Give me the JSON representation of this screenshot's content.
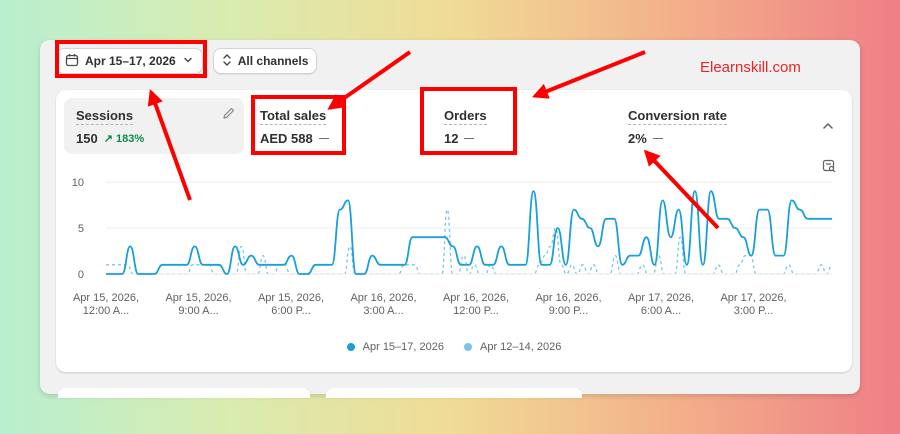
{
  "watermark": "Elearnskill.com",
  "toolbar": {
    "date_range": "Apr 15–17, 2026",
    "channels": "All channels"
  },
  "metrics": [
    {
      "label": "Sessions",
      "value": "150",
      "change": "183%",
      "change_direction": "up"
    },
    {
      "label": "Total sales",
      "value": "AED 588"
    },
    {
      "label": "Orders",
      "value": "12"
    },
    {
      "label": "Conversion rate",
      "value": "2%"
    }
  ],
  "chart_data": {
    "type": "line",
    "y_ticks": [
      "10",
      "5",
      "0"
    ],
    "ylim": [
      0,
      10
    ],
    "x_tick_labels": [
      [
        "Apr 15, 2026,",
        "12:00 A..."
      ],
      [
        "Apr 15, 2026,",
        "9:00 A..."
      ],
      [
        "Apr 15, 2026,",
        "6:00 P..."
      ],
      [
        "Apr 16, 2026,",
        "3:00 A..."
      ],
      [
        "Apr 16, 2026,",
        "12:00 P..."
      ],
      [
        "Apr 16, 2026,",
        "9:00 P..."
      ],
      [
        "Apr 17, 2026,",
        "6:00 A..."
      ],
      [
        "Apr 17, 2026,",
        "3:00 P..."
      ]
    ],
    "series": [
      {
        "name": "Apr 15–17, 2026",
        "color": "#1a9fd9",
        "style": "solid",
        "values": [
          0,
          0,
          0,
          3,
          0,
          0,
          0,
          1,
          1,
          1,
          1,
          3,
          1,
          1,
          1,
          0,
          3,
          1,
          2,
          1,
          1,
          1,
          1,
          2,
          0,
          0,
          1,
          1,
          1,
          7,
          8,
          0,
          0,
          2,
          1,
          1,
          1,
          1,
          4,
          4,
          4,
          4,
          4,
          3,
          1,
          1,
          3,
          1,
          1,
          3,
          1,
          1,
          1,
          9,
          1,
          1,
          5,
          1,
          7,
          6,
          5,
          3,
          6,
          6,
          1,
          2,
          2,
          4,
          1,
          8,
          4,
          7,
          1,
          9,
          1,
          9,
          6,
          6,
          5,
          4,
          2,
          7,
          7,
          2,
          2,
          8,
          7,
          6,
          6,
          6,
          6
        ]
      },
      {
        "name": "Apr 12–14, 2026",
        "color": "#7cc3e8",
        "style": "dashed",
        "values": [
          1,
          1,
          1,
          1,
          1,
          0,
          0,
          0,
          0,
          0,
          0,
          0,
          0,
          0,
          0,
          0,
          1,
          1,
          1,
          1,
          0,
          0,
          0,
          0,
          0,
          3,
          0,
          0,
          0,
          2,
          0,
          0,
          1,
          1,
          0,
          0,
          0,
          0,
          0,
          0,
          0,
          0,
          0,
          0,
          0,
          3,
          0,
          0,
          0,
          0,
          0,
          0,
          0,
          0,
          0,
          1,
          1,
          1,
          0,
          0,
          0,
          0,
          0,
          7,
          0,
          0,
          2,
          0,
          1,
          0,
          0,
          1,
          0,
          0,
          0,
          0,
          0,
          0,
          0,
          0,
          1,
          2,
          3,
          5,
          1,
          0,
          1,
          0,
          1,
          0,
          1,
          0,
          0,
          0,
          2,
          0,
          0,
          0,
          0,
          1,
          0,
          0,
          2,
          0,
          0,
          0,
          4,
          0,
          0,
          0,
          0,
          0,
          0,
          1,
          0,
          0,
          0,
          1,
          2,
          2,
          0,
          0,
          0,
          0,
          0,
          0,
          1,
          0,
          0,
          0,
          0,
          0,
          1,
          0,
          1
        ]
      }
    ]
  }
}
